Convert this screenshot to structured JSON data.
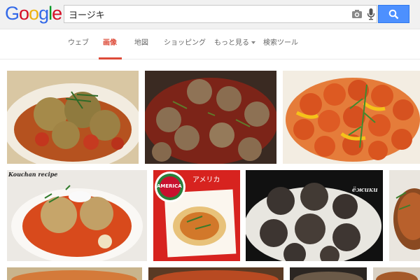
{
  "header": {
    "logo": [
      "G",
      "o",
      "o",
      "g",
      "l",
      "e"
    ],
    "logo_colors": [
      "#3369e8",
      "#d50f25",
      "#eeb211",
      "#3369e8",
      "#009925",
      "#d50f25"
    ],
    "search_value": "ヨージキ"
  },
  "tabs": [
    {
      "label": "ウェブ",
      "active": false
    },
    {
      "label": "画像",
      "active": true
    },
    {
      "label": "地図",
      "active": false
    },
    {
      "label": "ショッピング",
      "active": false
    },
    {
      "label": "もっと見る",
      "active": false
    },
    {
      "label": "検索ツール",
      "active": false
    }
  ],
  "colors": {
    "accent_red": "#dd4b39",
    "search_blue": "#4d90fe"
  },
  "results": {
    "image_captions": {
      "kouchan": "Kouchan recipe",
      "america_badge": "AMERICA",
      "america_title": "アメリカ",
      "ezhiki": "ёжики"
    }
  }
}
